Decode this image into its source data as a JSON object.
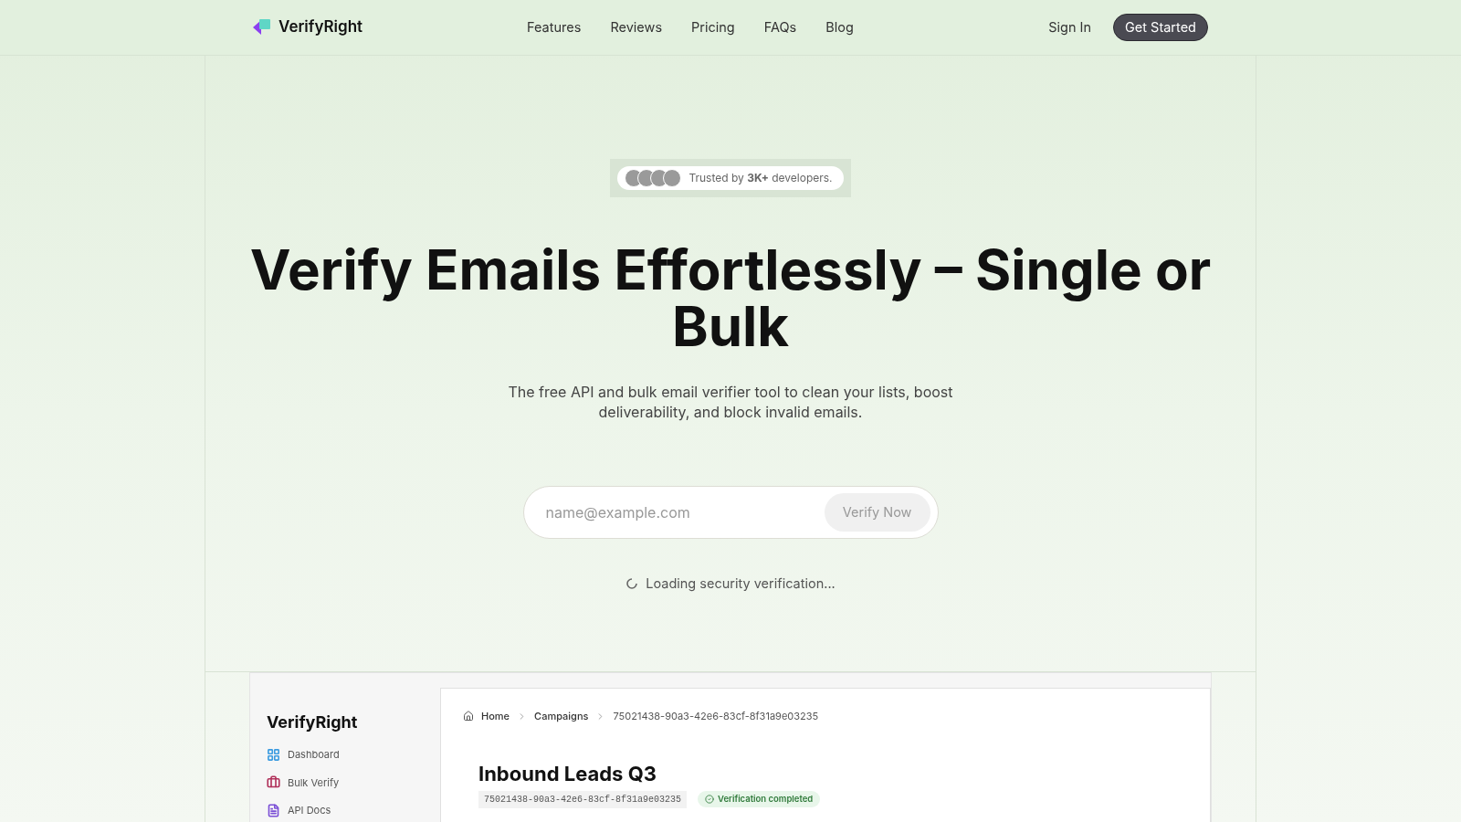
{
  "nav": {
    "brand": "VerifyRight",
    "links": [
      "Features",
      "Reviews",
      "Pricing",
      "FAQs",
      "Blog"
    ],
    "sign_in": "Sign In",
    "cta": "Get Started"
  },
  "hero": {
    "trust_badge": "Trusted by **3K+** developers.",
    "title": "Verify Emails Effortlessly – Single or Bulk",
    "subtitle": "The free API and bulk email verifier tool to clean your lists, boost deliverability, and block invalid emails.",
    "email_field": {
      "placeholder": "name@example.com"
    },
    "verify_button": {
      "label": "Verify Now",
      "disabled": true
    },
    "loading_text": "Loading security verification..."
  },
  "preview": {
    "sidebar": {
      "brand": "VerifyRight",
      "items": [
        {
          "label": "Dashboard",
          "kind": "grid",
          "color": "#3b9be0"
        },
        {
          "label": "Bulk Verify",
          "kind": "case",
          "color": "#b0305a"
        },
        {
          "label": "API Docs",
          "kind": "doc",
          "color": "#7b4fd6"
        }
      ]
    },
    "breadcrumb": [
      "Home",
      "Campaigns",
      "75021438-90a3-42e6-83cf-8f31a9e03235"
    ],
    "title": "Inbound Leads Q3",
    "id_tag": "75021438-90a3-42e6-83cf-8f31a9e03235",
    "status": "Verification completed"
  }
}
